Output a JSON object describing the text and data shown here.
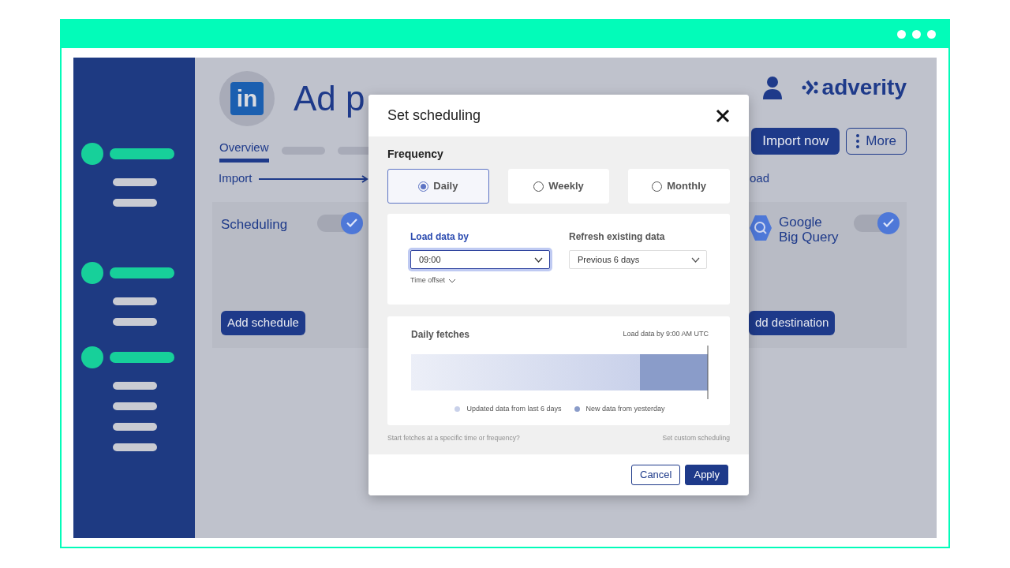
{
  "page": {
    "source_logo": "in",
    "title": "Ad p",
    "brand": "adverity",
    "tabs": [
      {
        "label": "Overview",
        "selected": true
      }
    ],
    "import_now": "Import now",
    "more": "More",
    "import_label": "Import",
    "load_label": "oad"
  },
  "source_card": {
    "title": "Scheduling",
    "on": true,
    "button": "Add schedule"
  },
  "destination_card": {
    "title": "Google Big Query",
    "on": true,
    "button": "dd destination"
  },
  "dialog": {
    "title": "Set scheduling",
    "frequency_label": "Frequency",
    "options": [
      {
        "label": "Daily",
        "selected": true
      },
      {
        "label": "Weekly",
        "selected": false
      },
      {
        "label": "Monthly",
        "selected": false
      }
    ],
    "load_by": {
      "label": "Load data by",
      "value": "09:00",
      "focused": true
    },
    "refresh": {
      "label": "Refresh existing data",
      "value": "Previous 6 days"
    },
    "time_offset": "Time offset",
    "fetches": {
      "title": "Daily fetches",
      "note": "Load data by 9:00 AM UTC",
      "legend": [
        {
          "label": "Updated data from last 6 days",
          "color": "#c9d1ea"
        },
        {
          "label": "New data from yesterday",
          "color": "#8a9cc9"
        }
      ]
    },
    "hint": "Start fetches at a specific time or frequency?",
    "custom_link": "Set custom scheduling",
    "cancel": "Cancel",
    "apply": "Apply"
  }
}
